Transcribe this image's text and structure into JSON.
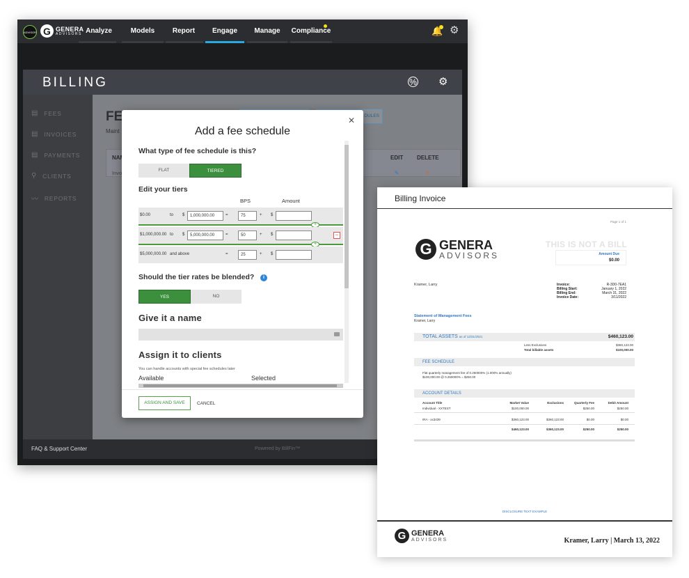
{
  "app": {
    "advisor_badge": "ADVISOR",
    "brand_name": "GENERA",
    "brand_sub": "ADVISORS",
    "nav": [
      "Analyze",
      "Models",
      "Report",
      "Engage",
      "Manage",
      "Compliance"
    ],
    "active_nav": "Engage",
    "accent": "#2aa8e0",
    "notification_color": "#f4e21a"
  },
  "billing": {
    "title": "BILLING",
    "sidebar": [
      "FEES",
      "INVOICES",
      "PAYMENTS",
      "CLIENTS",
      "REPORTS"
    ],
    "faq": "FAQ & Support Center",
    "powered": "Powered by BillFin™",
    "bg_title": "FE",
    "bg_sub": "Maint",
    "bg_btn2": "DULES",
    "table": {
      "col_name": "NAM",
      "col_edit": "EDIT",
      "col_delete": "DELETE",
      "row_name": "Invo"
    }
  },
  "modal": {
    "title": "Add a fee schedule",
    "q_type": "What type of fee schedule is this?",
    "type_options": [
      "FLAT",
      "TIERED"
    ],
    "type_selected": "TIERED",
    "tiers_heading": "Edit your tiers",
    "col_bps": "BPS",
    "col_amount": "Amount",
    "tiers": [
      {
        "from": "$0.00",
        "to_label": "to",
        "currency": "$",
        "to_value": "1,000,000.00",
        "bps": "75"
      },
      {
        "from": "$1,000,000.00",
        "to_label": "to",
        "currency": "$",
        "to_value": "5,000,000.00",
        "bps": "50"
      },
      {
        "from": "$5,000,000.00",
        "to_label": "and above",
        "currency": "",
        "to_value": "",
        "bps": "25"
      }
    ],
    "eq": "=",
    "plus": "+",
    "amount_currency": "$",
    "q_blend": "Should the tier rates be blended?",
    "blend_options": [
      "YES",
      "NO"
    ],
    "blend_selected": "YES",
    "name_heading": "Give it a name",
    "assign_heading": "Assign it to clients",
    "assign_note": "You can handle accounts with special fee schedules later",
    "available": "Available",
    "selected": "Selected",
    "assign_button": "ASSIGN AND SAVE",
    "cancel_button": "CANCEL"
  },
  "invoice": {
    "title": "Billing Invoice",
    "page": "Page 1 of 1",
    "brand_name": "GENERA",
    "brand_sub": "ADVISORS",
    "not_bill": "THIS IS NOT A BILL",
    "amount_due_label": "Amount Due",
    "amount_due": "$0.00",
    "client": "Kramer, Larry",
    "meta": [
      {
        "label": "Invoice:",
        "value": "R-3D0-7EA1"
      },
      {
        "label": "Billing Start:",
        "value": "January 1, 2022"
      },
      {
        "label": "Billing End:",
        "value": "March 31, 2022"
      },
      {
        "label": "Invoice Date:",
        "value": "3/11/2022"
      }
    ],
    "statement_title": "Statement of Management Fees",
    "statement_client": "Kramer, Larry",
    "total_assets_label": "TOTAL ASSETS",
    "total_assets_asof": "as of 12/31/2021",
    "total_assets_value": "$460,123.00",
    "less_exclusions_label": "Less Exclusions",
    "less_exclusions_value": "$360,123.00",
    "billable_label": "Total billable assets",
    "billable_value": "$100,000.00",
    "fee_schedule_label": "FEE SCHEDULE",
    "fee_line1": "Flat quarterly management fee of 0.250000% (1.000% annually)",
    "fee_line2": "$100,000.00 @ 0.250000% = $250.00",
    "account_details_label": "ACCOUNT DETAILS",
    "acct_headers": [
      "Account Title",
      "Market Value",
      "Exclusions",
      "Quarterly Fee",
      "Debit Amount"
    ],
    "accounts": [
      [
        "Individual - XXTEST",
        "$100,000.00",
        "",
        "$250.00",
        "$250.00"
      ],
      [
        "IRA - xx3439",
        "$360,123.00",
        "$360,123.00",
        "$0.00",
        "$0.00"
      ]
    ],
    "totals": [
      "",
      "$460,123.00",
      "$360,123.00",
      "$250.00",
      "$250.00"
    ],
    "disclosure": "DISCLOSURE TEXT EXAMPLE",
    "footer_right": "Kramer, Larry | March 13, 2022"
  }
}
